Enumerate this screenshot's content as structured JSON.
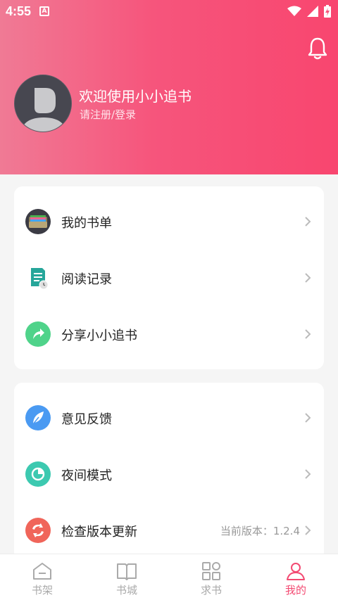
{
  "status_bar": {
    "time": "4:55",
    "badge": "A"
  },
  "header": {
    "welcome": "欢迎使用小小追书",
    "login": "请注册/登录"
  },
  "menu_group1": [
    {
      "label": "我的书单",
      "icon": "booklist-icon"
    },
    {
      "label": "阅读记录",
      "icon": "reading-record-icon"
    },
    {
      "label": "分享小小追书",
      "icon": "share-icon"
    }
  ],
  "menu_group2": [
    {
      "label": "意见反馈",
      "icon": "feedback-icon"
    },
    {
      "label": "夜间模式",
      "icon": "night-mode-icon"
    },
    {
      "label": "检查版本更新",
      "icon": "update-icon",
      "extra": "当前版本：1.2.4"
    }
  ],
  "nav": [
    {
      "label": "书架",
      "icon": "bookshelf-icon"
    },
    {
      "label": "书城",
      "icon": "bookstore-icon"
    },
    {
      "label": "求书",
      "icon": "request-book-icon"
    },
    {
      "label": "我的",
      "icon": "profile-icon",
      "active": true
    }
  ],
  "colors": {
    "accent": "#f34a72",
    "header_start": "#f07a95",
    "header_end": "#f8466f"
  }
}
